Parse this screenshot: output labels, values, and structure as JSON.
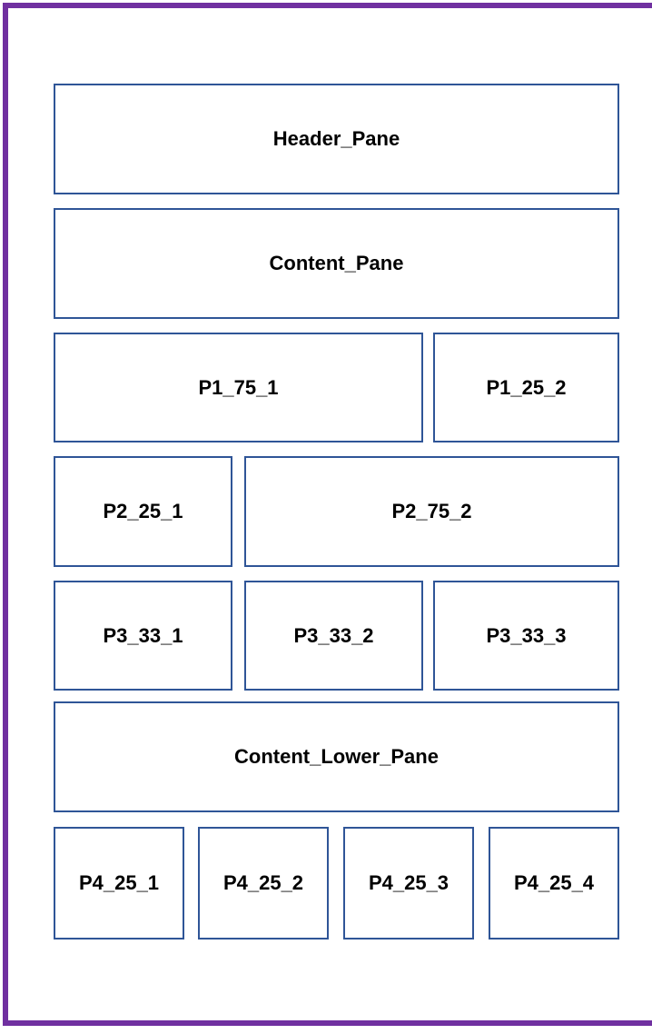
{
  "layout_diagram": {
    "frame_color": "#7030a0",
    "pane_border_color": "#2f5597",
    "panes": {
      "header": "Header_Pane",
      "content": "Content_Pane",
      "p1_75_1": "P1_75_1",
      "p1_25_2": "P1_25_2",
      "p2_25_1": "P2_25_1",
      "p2_75_2": "P2_75_2",
      "p3_33_1": "P3_33_1",
      "p3_33_2": "P3_33_2",
      "p3_33_3": "P3_33_3",
      "content_lower": "Content_Lower_Pane",
      "p4_25_1": "P4_25_1",
      "p4_25_2": "P4_25_2",
      "p4_25_3": "P4_25_3",
      "p4_25_4": "P4_25_4"
    }
  }
}
